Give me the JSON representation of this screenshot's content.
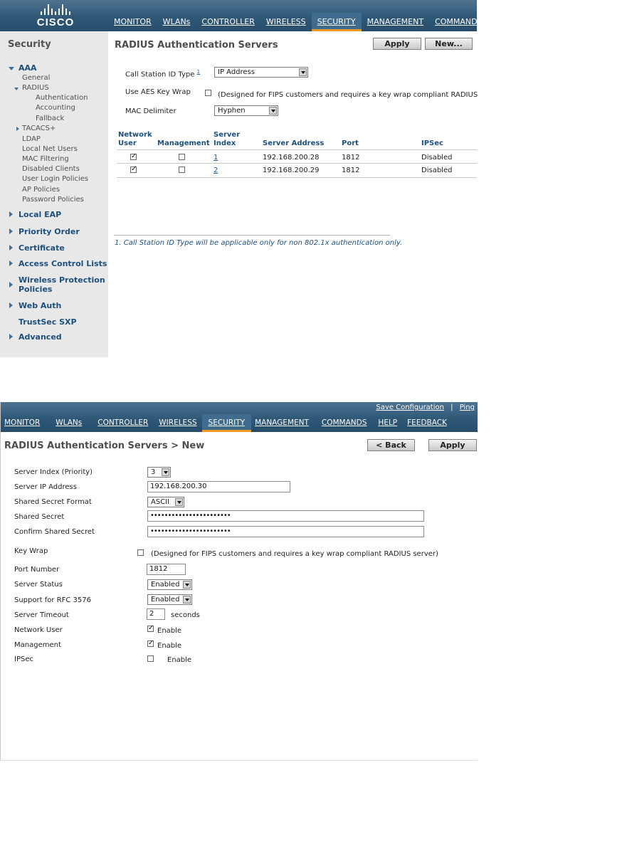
{
  "brand": "CISCO",
  "screen1": {
    "nav": [
      "MONITOR",
      "WLANs",
      "CONTROLLER",
      "WIRELESS",
      "SECURITY",
      "MANAGEMENT",
      "COMMANDS"
    ],
    "active_nav": "SECURITY",
    "sidebar": {
      "title": "Security",
      "aaa": "AAA",
      "general": "General",
      "radius": "RADIUS",
      "radius_items": [
        "Authentication",
        "Accounting",
        "Fallback"
      ],
      "tacacs": "TACACS+",
      "aaa_items": [
        "LDAP",
        "Local Net Users",
        "MAC Filtering",
        "Disabled Clients",
        "User Login Policies",
        "AP Policies",
        "Password Policies"
      ],
      "sections": [
        "Local EAP",
        "Priority Order",
        "Certificate",
        "Access Control Lists",
        "Wireless Protection",
        "Policies",
        "Web Auth",
        "TrustSec SXP",
        "Advanced"
      ]
    },
    "title": "RADIUS Authentication Servers",
    "apply": "Apply",
    "new": "New...",
    "call_station_label": "Call Station ID Type",
    "call_station_sup": "1",
    "call_station_value": "IP Address",
    "aes_label": "Use AES Key Wrap",
    "aes_note": "(Designed for FIPS customers and requires a key wrap compliant RADIUS",
    "mac_label": "MAC Delimiter",
    "mac_value": "Hyphen",
    "table": {
      "headers": [
        "Network",
        "User",
        "Management",
        "Server",
        "Index",
        "Server Address",
        "Port",
        "IPSec"
      ],
      "rows": [
        {
          "network_user": "✓",
          "management": "",
          "index": "1",
          "address": "192.168.200.28",
          "port": "1812",
          "ipsec": "Disabled"
        },
        {
          "network_user": "✓",
          "management": "",
          "index": "2",
          "address": "192.168.200.29",
          "port": "1812",
          "ipsec": "Disabled"
        }
      ]
    },
    "footnote": "1. Call Station ID Type will be applicable only for non 802.1x authentication only."
  },
  "screen2": {
    "top_links": [
      "Save Configuration",
      "Ping"
    ],
    "nav": [
      "MONITOR",
      "WLANs",
      "CONTROLLER",
      "WIRELESS",
      "SECURITY",
      "MANAGEMENT",
      "COMMANDS",
      "HELP",
      "FEEDBACK"
    ],
    "active_nav": "SECURITY",
    "title": "RADIUS Authentication Servers > New",
    "back": "< Back",
    "apply": "Apply",
    "fields": {
      "server_index_label": "Server Index (Priority)",
      "server_index_value": "3",
      "server_ip_label": "Server IP Address",
      "server_ip_value": "192.168.200.30",
      "secret_format_label": "Shared Secret Format",
      "secret_format_value": "ASCII",
      "secret_label": "Shared Secret",
      "secret_value": "•••••••••••••••••••••••",
      "confirm_label": "Confirm Shared Secret",
      "confirm_value": "•••••••••••••••••••••••",
      "key_wrap_label": "Key Wrap",
      "key_wrap_note": "(Designed for FIPS customers and requires a key wrap compliant RADIUS server)",
      "port_label": "Port Number",
      "port_value": "1812",
      "status_label": "Server Status",
      "status_value": "Enabled",
      "rfc_label": "Support for RFC 3576",
      "rfc_value": "Enabled",
      "timeout_label": "Server Timeout",
      "timeout_value": "2",
      "timeout_unit": "seconds",
      "network_user_label": "Network User",
      "management_label": "Management",
      "ipsec_label": "IPSec",
      "enable": "Enable",
      "check": "✓"
    }
  }
}
